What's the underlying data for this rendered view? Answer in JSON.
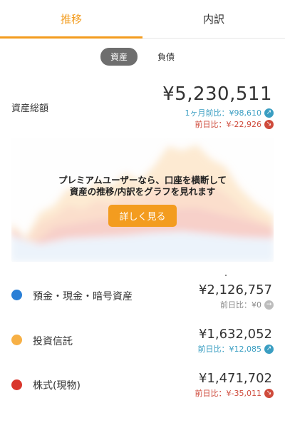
{
  "tabs": [
    {
      "label": "推移",
      "active": true
    },
    {
      "label": "内訳",
      "active": false
    }
  ],
  "segments": [
    {
      "label": "資産",
      "active": true
    },
    {
      "label": "負債",
      "active": false
    }
  ],
  "total": {
    "label": "資産総額",
    "value": "¥5,230,511",
    "month_change": "1ヶ月前比：¥98,610",
    "day_change": "前日比：¥-22,926"
  },
  "promo": {
    "line1": "プレミアムユーザーなら、口座を横断して",
    "line2": "資産の推移/内訳をグラフを見れます",
    "button": "詳しく見る"
  },
  "categories": [
    {
      "name": "預金・現金・暗号資産",
      "value": "¥2,126,757",
      "change": "前日比：¥0",
      "trend": "flat",
      "color": "#2a7fd6"
    },
    {
      "name": "投資信託",
      "value": "¥1,632,052",
      "change": "前日比：¥12,085",
      "trend": "up",
      "color": "#f7b045"
    },
    {
      "name": "株式(現物)",
      "value": "¥1,471,702",
      "change": "前日比：¥-35,011",
      "trend": "down",
      "color": "#d9362c"
    }
  ],
  "colors": {
    "accent": "#f39c1f",
    "up": "#3a9ec2",
    "down": "#cf4b3c"
  }
}
